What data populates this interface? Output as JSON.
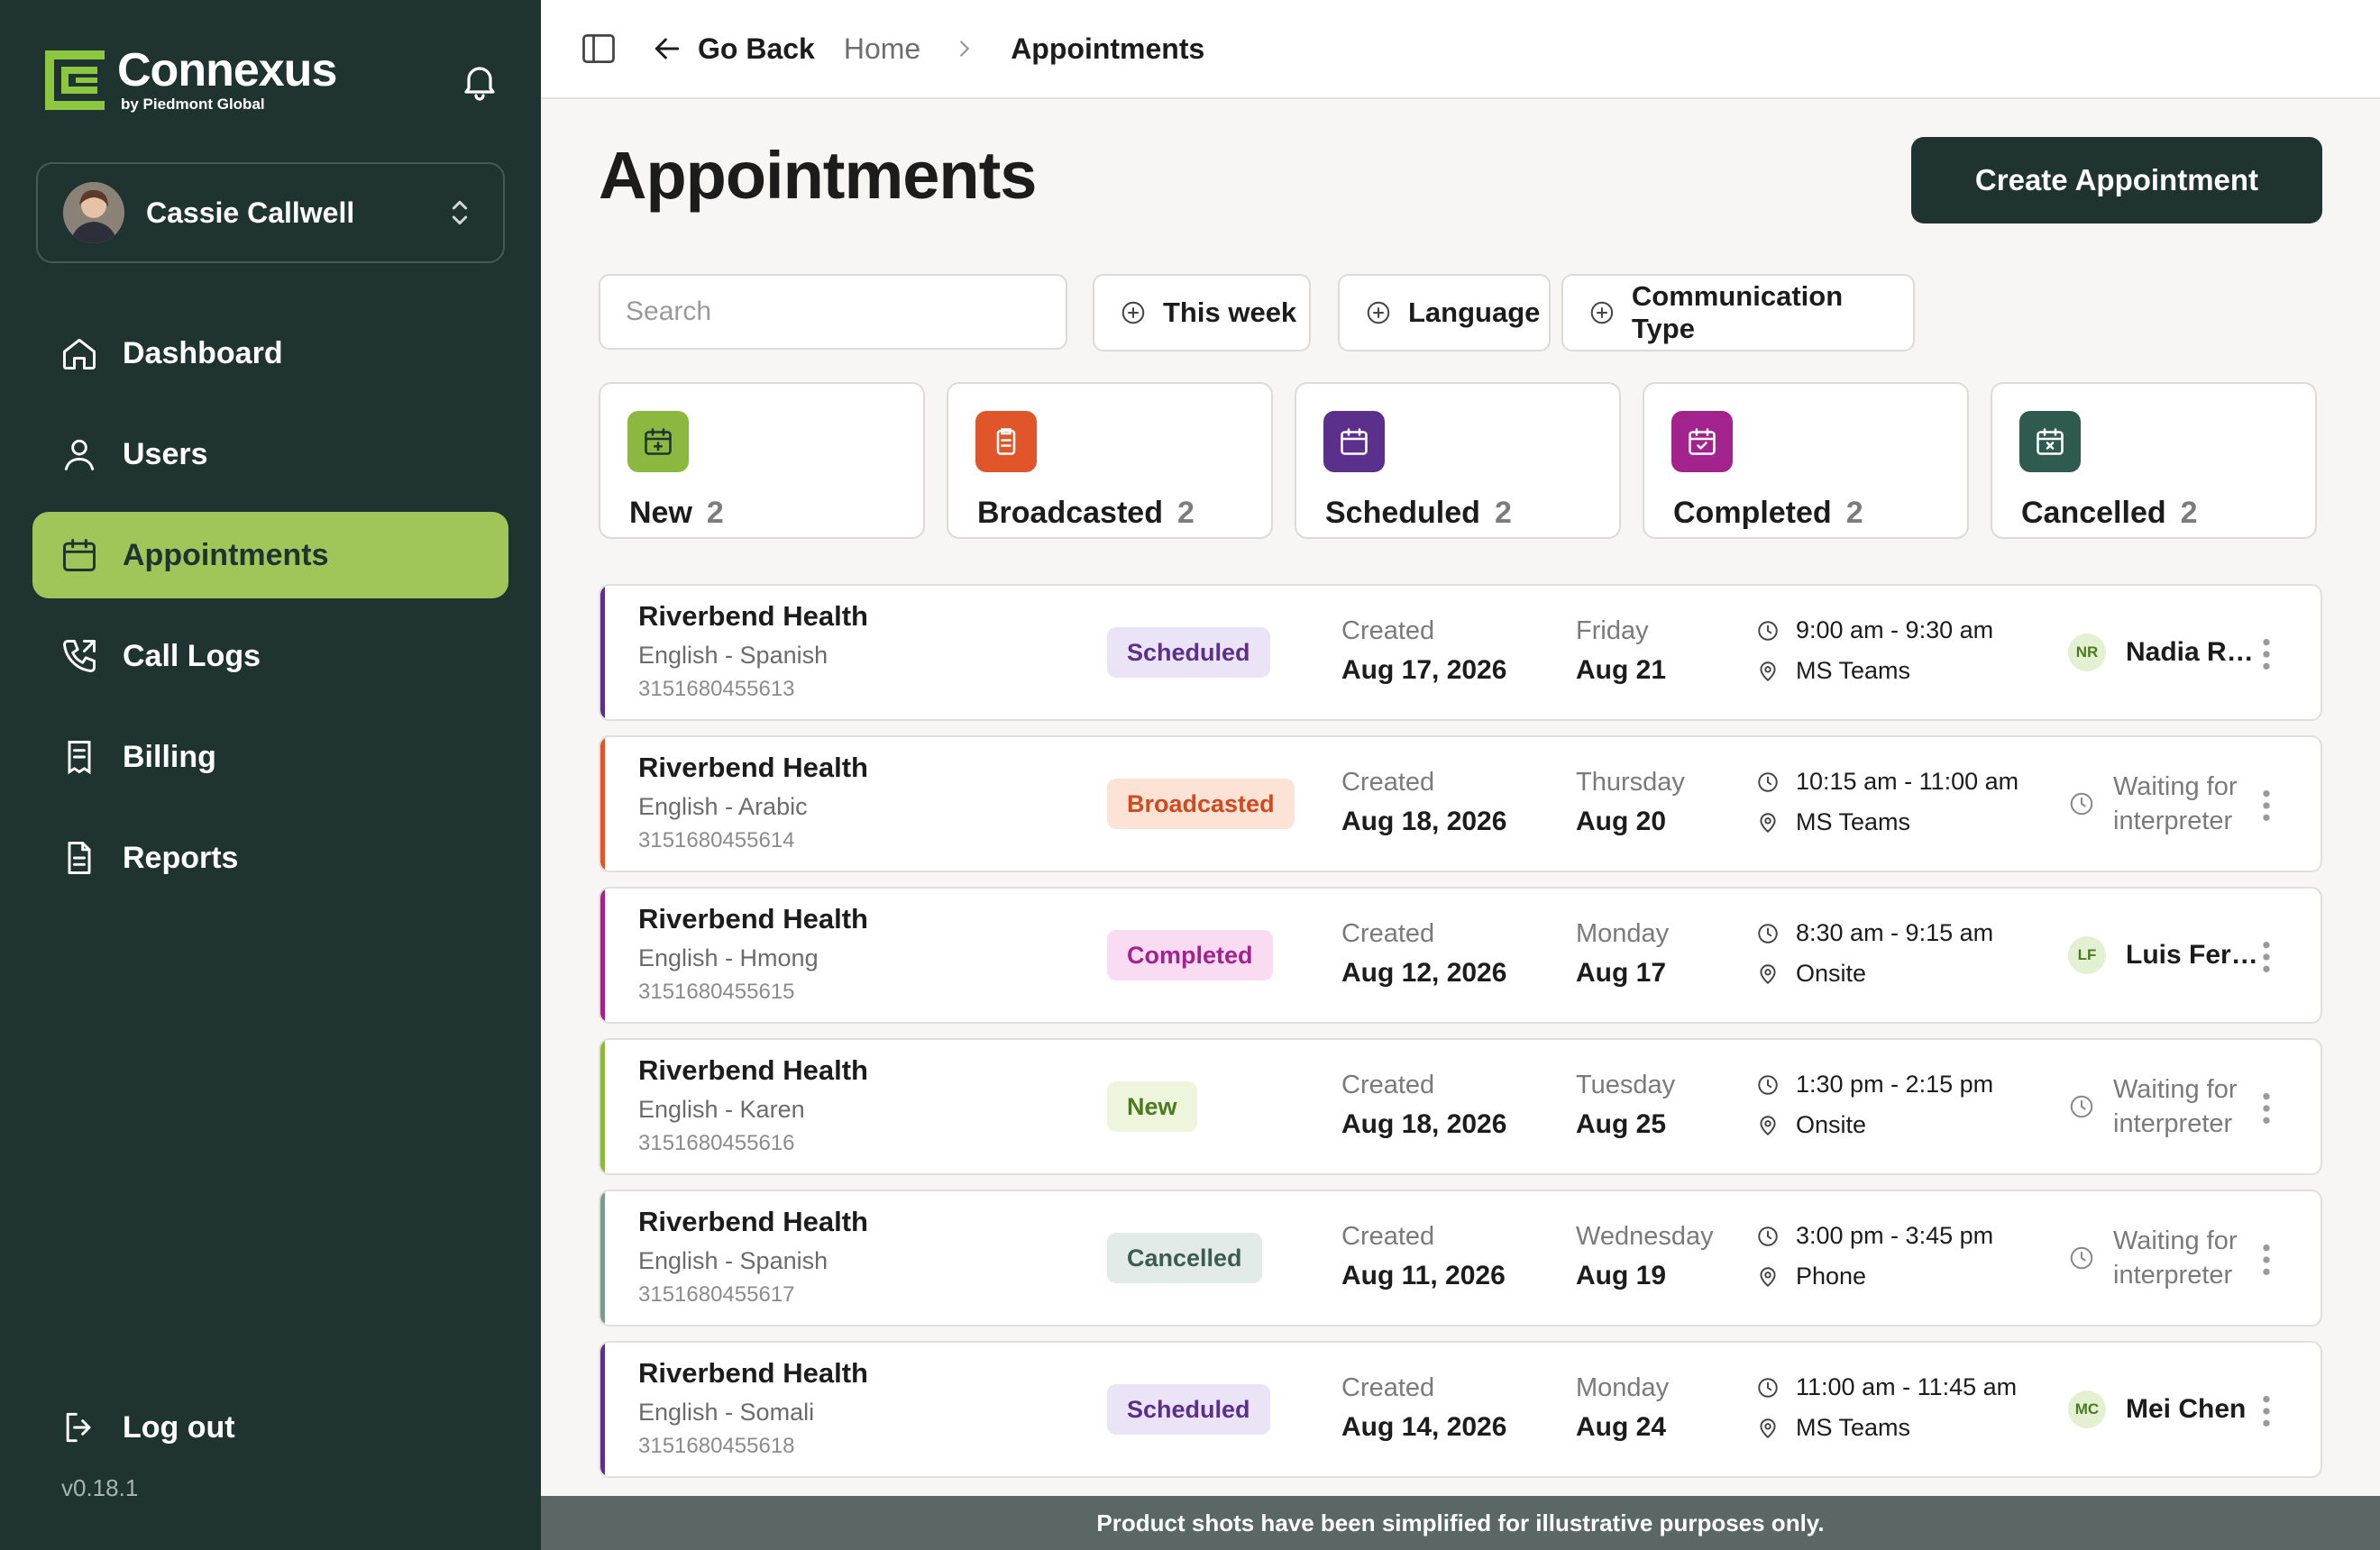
{
  "brand": {
    "name": "Connexus",
    "sub": "by Piedmont Global",
    "color": "#8dc63f"
  },
  "user": {
    "name": "Cassie Callwell"
  },
  "nav": [
    {
      "label": "Dashboard",
      "icon": "home-icon",
      "active": false
    },
    {
      "label": "Users",
      "icon": "user-icon",
      "active": false
    },
    {
      "label": "Appointments",
      "icon": "calendar-icon",
      "active": true
    },
    {
      "label": "Call Logs",
      "icon": "phone-icon",
      "active": false
    },
    {
      "label": "Billing",
      "icon": "receipt-icon",
      "active": false
    },
    {
      "label": "Reports",
      "icon": "file-icon",
      "active": false
    }
  ],
  "logout_label": "Log out",
  "version": "v0.18.1",
  "topbar": {
    "back_label": "Go Back",
    "crumb_home": "Home",
    "crumb_current": "Appointments"
  },
  "page": {
    "title": "Appointments",
    "create_label": "Create Appointment"
  },
  "search": {
    "placeholder": "Search"
  },
  "filters": [
    "This week",
    "Language",
    "Communication Type"
  ],
  "statuses": [
    {
      "label": "New",
      "count": "2",
      "color": "#8bb83f"
    },
    {
      "label": "Broadcasted",
      "count": "2",
      "color": "#e0562a"
    },
    {
      "label": "Scheduled",
      "count": "2",
      "color": "#5b2f8c"
    },
    {
      "label": "Completed",
      "count": "2",
      "color": "#a3238e"
    },
    {
      "label": "Cancelled",
      "count": "2",
      "color": "#2f5a4f"
    }
  ],
  "appointments": [
    {
      "customer": "Riverbend Health",
      "language": "English - Spanish",
      "id": "3151680455613",
      "status": "Scheduled",
      "created_label": "Created",
      "created": "Aug 17, 2026",
      "weekday": "Friday",
      "date": "Aug 21",
      "time": "9:00 am - 9:30 am",
      "location": "MS Teams",
      "assignee_initials": "NR",
      "assignee": "Nadia Ra...",
      "waiting": ""
    },
    {
      "customer": "Riverbend Health",
      "language": "English - Arabic",
      "id": "3151680455614",
      "status": "Broadcasted",
      "created_label": "Created",
      "created": "Aug 18, 2026",
      "weekday": "Thursday",
      "date": "Aug 20",
      "time": "10:15 am - 11:00 am",
      "location": "MS Teams",
      "assignee_initials": "",
      "assignee": "",
      "waiting": "Waiting for interpreter"
    },
    {
      "customer": "Riverbend Health",
      "language": "English - Hmong",
      "id": "3151680455615",
      "status": "Completed",
      "created_label": "Created",
      "created": "Aug 12, 2026",
      "weekday": "Monday",
      "date": "Aug 17",
      "time": "8:30 am - 9:15 am",
      "location": "Onsite",
      "assignee_initials": "LF",
      "assignee": "Luis Ferr...",
      "waiting": ""
    },
    {
      "customer": "Riverbend Health",
      "language": "English - Karen",
      "id": "3151680455616",
      "status": "New",
      "created_label": "Created",
      "created": "Aug 18, 2026",
      "weekday": "Tuesday",
      "date": "Aug 25",
      "time": "1:30 pm - 2:15 pm",
      "location": "Onsite",
      "assignee_initials": "",
      "assignee": "",
      "waiting": "Waiting for interpreter"
    },
    {
      "customer": "Riverbend Health",
      "language": "English - Spanish",
      "id": "3151680455617",
      "status": "Cancelled",
      "created_label": "Created",
      "created": "Aug 11, 2026",
      "weekday": "Wednesday",
      "date": "Aug 19",
      "time": "3:00 pm - 3:45 pm",
      "location": "Phone",
      "assignee_initials": "",
      "assignee": "",
      "waiting": "Waiting for interpreter"
    },
    {
      "customer": "Riverbend Health",
      "language": "English - Somali",
      "id": "3151680455618",
      "status": "Scheduled",
      "created_label": "Created",
      "created": "Aug 14, 2026",
      "weekday": "Monday",
      "date": "Aug 24",
      "time": "11:00 am - 11:45 am",
      "location": "MS Teams",
      "assignee_initials": "MC",
      "assignee": "Mei Chen",
      "waiting": ""
    }
  ],
  "badge_styles": {
    "Scheduled": {
      "bg": "#ebe3f6",
      "fg": "#5b2f8c",
      "accent": "#5b2f8c"
    },
    "Broadcasted": {
      "bg": "#fde2d6",
      "fg": "#d04a1f",
      "accent": "#e0562a"
    },
    "Completed": {
      "bg": "#f9dcf1",
      "fg": "#a3238e",
      "accent": "#a3238e"
    },
    "New": {
      "bg": "#edf5dc",
      "fg": "#4c7a1f",
      "accent": "#8bb83f"
    },
    "Cancelled": {
      "bg": "#e3ebe8",
      "fg": "#3c5c52",
      "accent": "#7b9a91"
    }
  },
  "footer_note": "Product shots have been simplified for illustrative purposes only."
}
